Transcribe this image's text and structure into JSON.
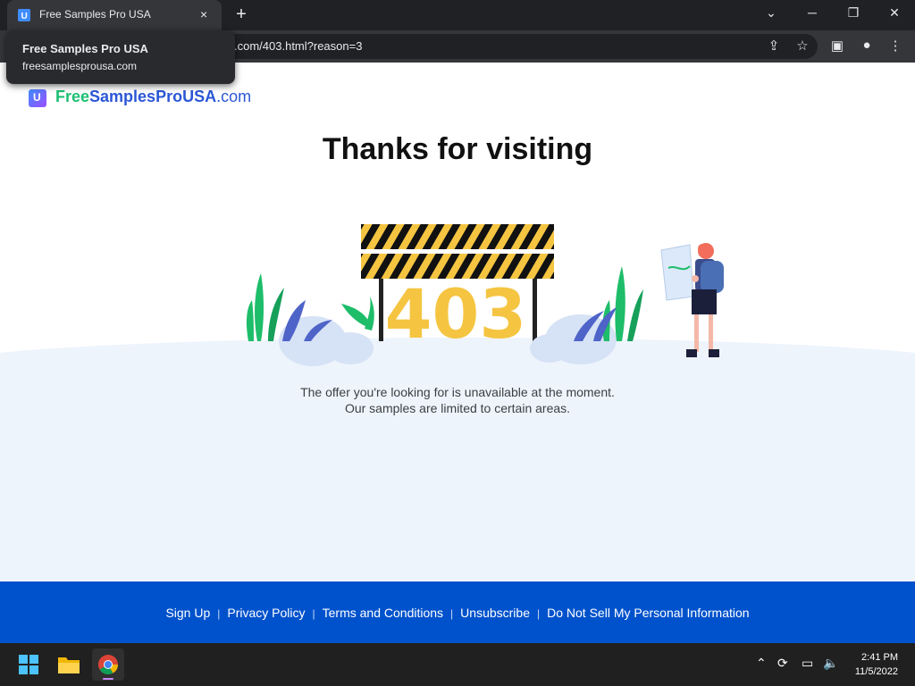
{
  "browser": {
    "tab_title": "Free Samples Pro USA",
    "tab_close": "×",
    "new_tab": "+",
    "url": ".com/403.html?reason=3",
    "tooltip_title": "Free Samples Pro USA",
    "tooltip_url": "freesamplesprousa.com"
  },
  "logo": {
    "free": "Free",
    "samples": "Samples",
    "pro": "Pro",
    "usa": "USA",
    "dotcom": ".com"
  },
  "page": {
    "heading": "Thanks for visiting",
    "error_code": "403",
    "message_line1": "The offer you're looking for is unavailable at the moment.",
    "message_line2": "Our samples are limited to certain areas."
  },
  "footer": {
    "links": [
      "Sign Up",
      "Privacy Policy",
      "Terms and Conditions",
      "Unsubscribe",
      "Do Not Sell My Personal Information"
    ],
    "separator": "|"
  },
  "taskbar": {
    "time": "2:41 PM",
    "date": "11/5/2022"
  },
  "colors": {
    "brand_blue": "#0052cc",
    "logo_green": "#1dbf73",
    "logo_blue": "#2b57d6",
    "stripe_yellow": "#f5c542",
    "ground": "#eef4fc"
  },
  "icons": [
    "minimize-icon",
    "restore-icon",
    "close-icon",
    "share-icon",
    "star-icon",
    "sidebar-icon",
    "profile-icon",
    "menu-icon",
    "windows-start-icon",
    "file-explorer-icon",
    "chrome-icon",
    "chevron-up-icon",
    "sync-icon",
    "network-icon",
    "volume-icon"
  ]
}
